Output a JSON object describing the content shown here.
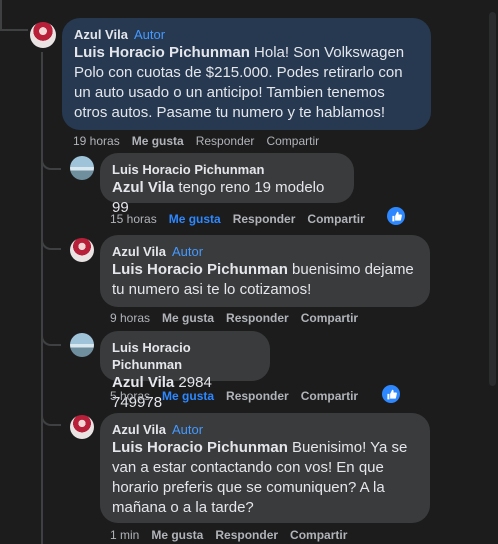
{
  "comments": [
    {
      "author": "Azul Vila",
      "badge": "Autor",
      "mention": "Luis Horacio Pichunman",
      "text": " Hola! Son Volkswagen Polo con cuotas de $215.000. Podes retirarlo con un auto usado o un anticipo! Tambien tenemos otros autos. Pasame tu numero y te hablamos!",
      "time": "19 horas",
      "like": "Me gusta",
      "reply": "Responder",
      "share": "Compartir"
    },
    {
      "author": "Luis Horacio Pichunman",
      "mention": "Azul Vila",
      "text": " tengo reno 19 modelo 99",
      "time": "15 horas",
      "like": "Me gusta",
      "reply": "Responder",
      "share": "Compartir"
    },
    {
      "author": "Azul Vila",
      "badge": "Autor",
      "mention": "Luis Horacio Pichunman",
      "text": " buenisimo dejame tu numero asi te lo cotizamos!",
      "time": "9 horas",
      "like": "Me gusta",
      "reply": "Responder",
      "share": "Compartir"
    },
    {
      "author": "Luis Horacio Pichunman",
      "mention": "Azul Vila",
      "text": " 2984 749978",
      "time": "5 horas",
      "like": "Me gusta",
      "reply": "Responder",
      "share": "Compartir"
    },
    {
      "author": "Azul Vila",
      "badge": "Autor",
      "mention": "Luis Horacio Pichunman",
      "text": " Buenisimo! Ya se van a estar contactando con vos! En que horario preferis que se comuniquen? A la mañana o a la tarde?",
      "time": "1 min",
      "like": "Me gusta",
      "reply": "Responder",
      "share": "Compartir"
    }
  ],
  "colors": {
    "background": "#1c1c1d",
    "bubble": "#3a3b3c",
    "highlight_bubble": "#263951",
    "accent": "#2d88ff",
    "badge": "#4599ff"
  }
}
